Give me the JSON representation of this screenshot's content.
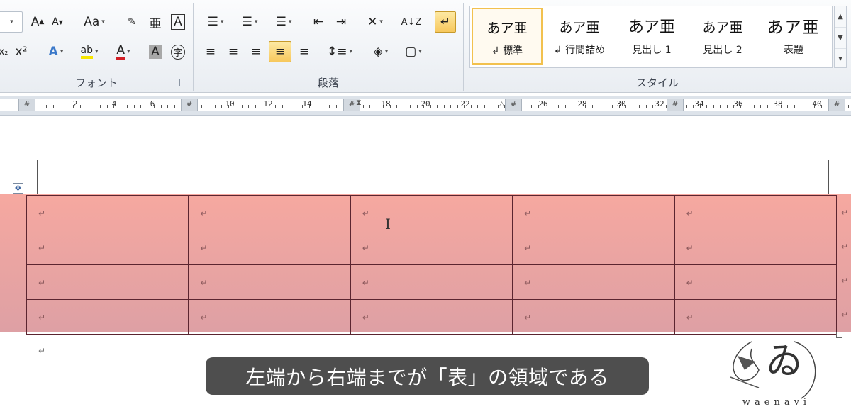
{
  "ribbon": {
    "font_group": {
      "label": "フォント",
      "row1": {
        "grow": "A",
        "shrink": "A",
        "change_case": "Aa",
        "phonetic": "亜",
        "char_border": "A"
      },
      "row2": {
        "subscript": "x₂",
        "superscript": "x²",
        "text_effects": "A",
        "highlight": "ab",
        "font_color": "A",
        "char_shading": "A",
        "enclose": "字"
      }
    },
    "paragraph_group": {
      "label": "段落",
      "row1": {
        "bullets": "☰",
        "numbering": "☰",
        "multilevel": "☰",
        "decrease_indent": "⇤",
        "increase_indent": "⇥",
        "sort": "A↓Z",
        "show_marks": "↵"
      },
      "row2": {
        "align_left": "≡",
        "center": "≡",
        "align_right": "≡",
        "justify": "≡",
        "distributed": "≡",
        "line_spacing": "↕≡",
        "shading": "◈",
        "borders": "▢"
      }
    },
    "style_group": {
      "label": "スタイル",
      "styles": [
        {
          "sample": "あア亜",
          "name": "↲ 標準"
        },
        {
          "sample": "あア亜",
          "name": "↲ 行間詰め"
        },
        {
          "sample": "あア亜",
          "name": "見出し 1"
        },
        {
          "sample": "あア亜",
          "name": "見出し 2"
        },
        {
          "sample": "あア亜",
          "name": "表題"
        }
      ]
    }
  },
  "ruler": {
    "numbers": [
      "2",
      "4",
      "6",
      "10",
      "12",
      "14",
      "18",
      "20",
      "22",
      "26",
      "28",
      "30",
      "32",
      "34",
      "36",
      "38",
      "40"
    ]
  },
  "document": {
    "table": {
      "rows": 4,
      "cols": 5,
      "cell_mark": "↵"
    },
    "paragraph_mark": "↵"
  },
  "subtitle": "左端から右端までが「表」の領域である",
  "watermark": {
    "text": "waenavi"
  },
  "colors": {
    "table_band": "#f6a8a0",
    "table_border": "#5b2530",
    "subtitle_bg": "#444444"
  }
}
